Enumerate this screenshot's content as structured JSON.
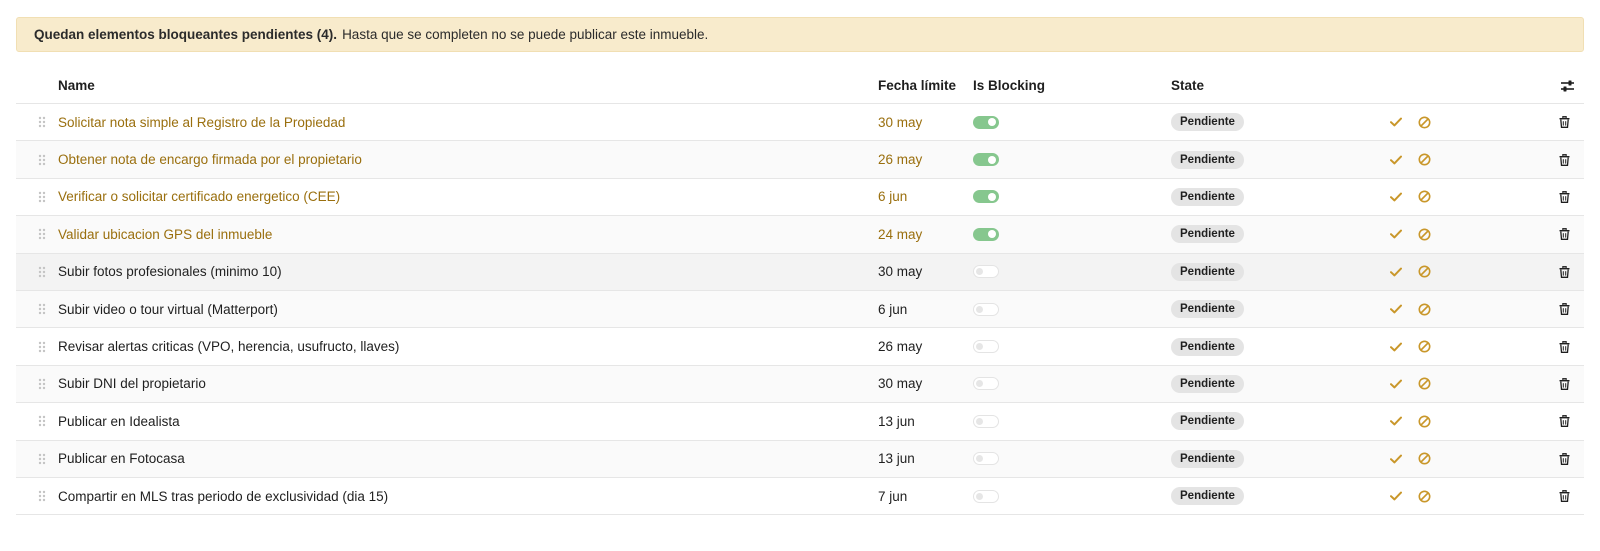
{
  "banner": {
    "bold": "Quedan elementos bloqueantes pendientes (4).",
    "text": "Hasta que se completen no se puede publicar este inmueble."
  },
  "table": {
    "headers": {
      "name": "Name",
      "deadline": "Fecha límite",
      "is_blocking": "Is Blocking",
      "state": "State"
    },
    "rows": [
      {
        "name": "Solicitar nota simple al Registro de la Propiedad",
        "deadline": "30 may",
        "is_blocking": true,
        "state": "Pendiente"
      },
      {
        "name": "Obtener nota de encargo firmada por el propietario",
        "deadline": "26 may",
        "is_blocking": true,
        "state": "Pendiente"
      },
      {
        "name": "Verificar o solicitar certificado energetico (CEE)",
        "deadline": "6 jun",
        "is_blocking": true,
        "state": "Pendiente"
      },
      {
        "name": "Validar ubicacion GPS del inmueble",
        "deadline": "24 may",
        "is_blocking": true,
        "state": "Pendiente"
      },
      {
        "name": "Subir fotos profesionales (minimo 10)",
        "deadline": "30 may",
        "is_blocking": false,
        "state": "Pendiente"
      },
      {
        "name": "Subir video o tour virtual (Matterport)",
        "deadline": "6 jun",
        "is_blocking": false,
        "state": "Pendiente"
      },
      {
        "name": "Revisar alertas criticas (VPO, herencia, usufructo, llaves)",
        "deadline": "26 may",
        "is_blocking": false,
        "state": "Pendiente"
      },
      {
        "name": "Subir DNI del propietario",
        "deadline": "30 may",
        "is_blocking": false,
        "state": "Pendiente"
      },
      {
        "name": "Publicar en Idealista",
        "deadline": "13 jun",
        "is_blocking": false,
        "state": "Pendiente"
      },
      {
        "name": "Publicar en Fotocasa",
        "deadline": "13 jun",
        "is_blocking": false,
        "state": "Pendiente"
      },
      {
        "name": "Compartir en MLS tras periodo de exclusividad (dia 15)",
        "deadline": "7 jun",
        "is_blocking": false,
        "state": "Pendiente"
      }
    ]
  },
  "icons": {
    "settings": "sliders-icon",
    "drag": "drag-handle-icon",
    "approve": "check-icon",
    "cancel": "ban-icon",
    "delete": "trash-icon"
  },
  "colors": {
    "banner_bg": "#f8ebcc",
    "blocking_text": "#9a6f0e",
    "action_icon": "#c9972a",
    "toggle_on": "#86c78e",
    "badge_bg": "#e4e4e4"
  }
}
